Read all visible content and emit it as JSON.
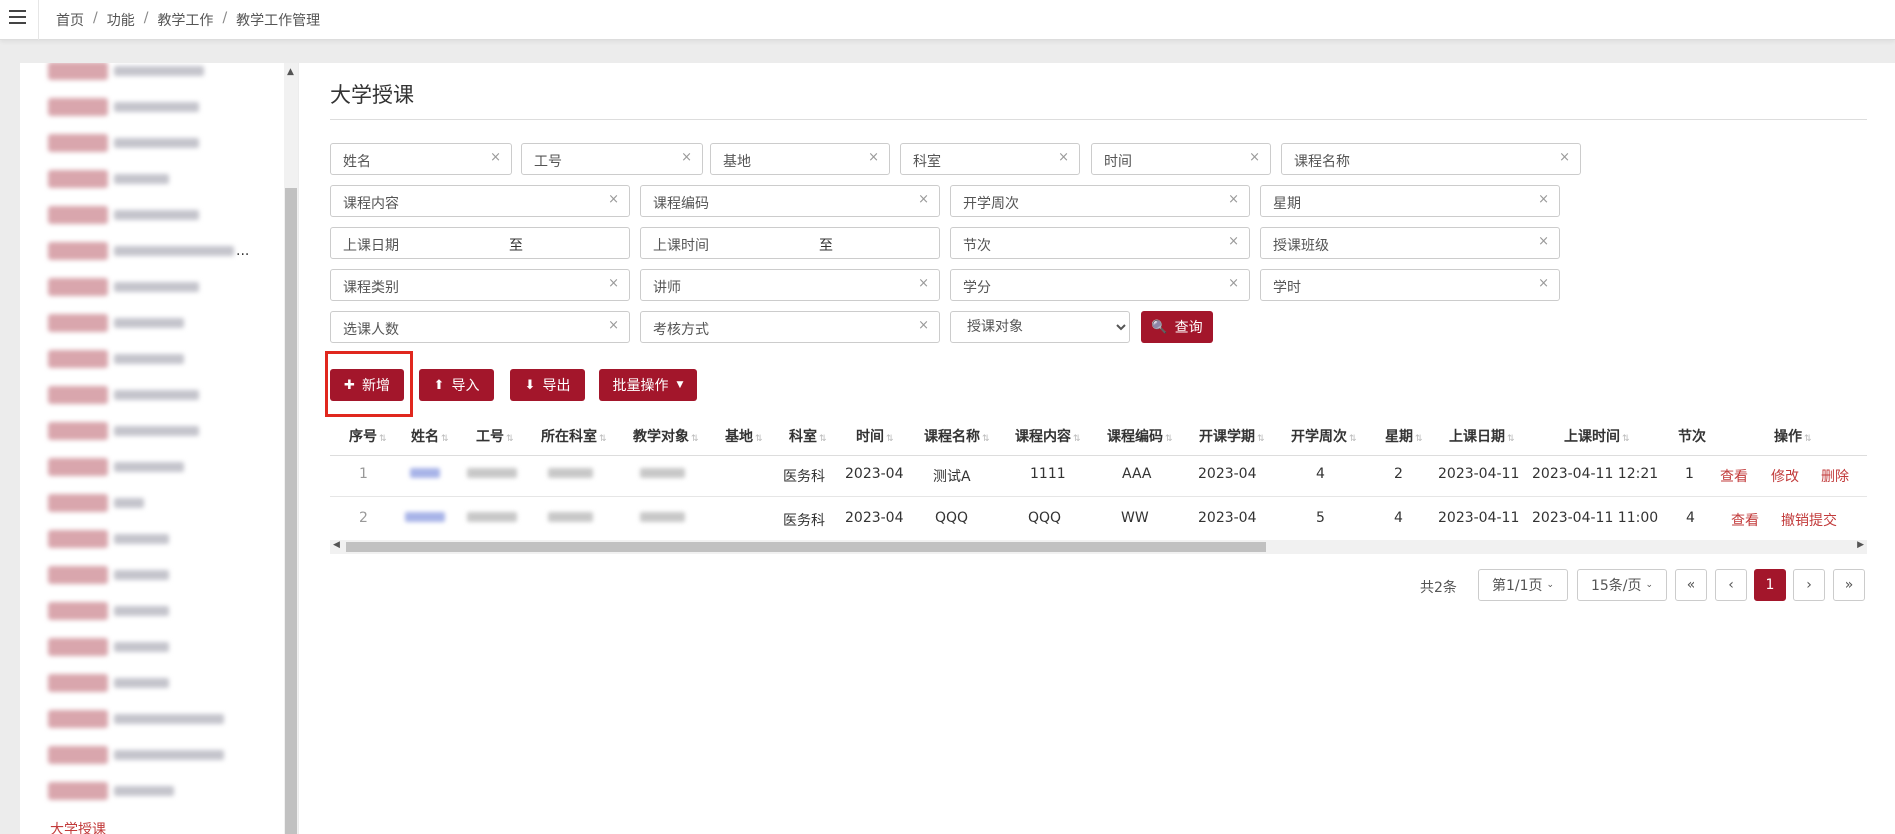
{
  "breadcrumb": [
    "首页",
    "功能",
    "教学工作",
    "教学工作管理"
  ],
  "page_title": "大学授课",
  "sidebar": {
    "active_label": "大学授课",
    "blurred_items": [
      {
        "text_w": 90
      },
      {
        "text_w": 85
      },
      {
        "text_w": 85
      },
      {
        "text_w": 55
      },
      {
        "text_w": 85
      },
      {
        "text_w": 120,
        "ellipsis": "..."
      },
      {
        "text_w": 85
      },
      {
        "text_w": 70
      },
      {
        "text_w": 70
      },
      {
        "text_w": 85
      },
      {
        "text_w": 85
      },
      {
        "text_w": 70
      },
      {
        "text_w": 30
      },
      {
        "text_w": 55
      },
      {
        "text_w": 55
      },
      {
        "text_w": 55
      },
      {
        "text_w": 55
      },
      {
        "text_w": 55
      },
      {
        "text_w": 110
      },
      {
        "text_w": 110
      },
      {
        "text_w": 60
      }
    ]
  },
  "filters": {
    "name": "姓名",
    "job_no": "工号",
    "base": "基地",
    "dept": "科室",
    "time": "时间",
    "course_name": "课程名称",
    "course_content": "课程内容",
    "course_code": "课程编码",
    "start_week": "开学周次",
    "weekday": "星期",
    "class_date": "上课日期",
    "class_time": "上课时间",
    "to": "至",
    "period": "节次",
    "class_group": "授课班级",
    "course_type": "课程类别",
    "lecturer": "讲师",
    "credit": "学分",
    "hours": "学时",
    "enroll_count": "选课人数",
    "exam_method": "考核方式",
    "target_select": "授课对象",
    "clear": "×"
  },
  "buttons": {
    "query": "查询",
    "add": "新增",
    "import": "导入",
    "export": "导出",
    "batch": "批量操作"
  },
  "table": {
    "columns": [
      "序号",
      "姓名",
      "工号",
      "所在科室",
      "教学对象",
      "基地",
      "科室",
      "时间",
      "课程名称",
      "课程内容",
      "课程编码",
      "开课学期",
      "开学周次",
      "星期",
      "上课日期",
      "上课时间",
      "节次",
      "操作"
    ],
    "rows": [
      {
        "seq": "1",
        "dept": "医务科",
        "time": "2023-04",
        "course_name": "测试A",
        "course_content": "1111",
        "course_code": "AAA",
        "term": "2023-04",
        "week": "4",
        "weekday": "2",
        "date": "2023-04-11",
        "datetime": "2023-04-11 12:21",
        "period": "1",
        "actions": [
          "查看",
          "修改",
          "删除"
        ]
      },
      {
        "seq": "2",
        "dept": "医务科",
        "time": "2023-04",
        "course_name": "QQQ",
        "course_content": "QQQ",
        "course_code": "WW",
        "term": "2023-04",
        "week": "5",
        "weekday": "4",
        "date": "2023-04-11",
        "datetime": "2023-04-11 11:00",
        "period": "4",
        "actions": [
          "查看",
          "撤销提交"
        ]
      }
    ]
  },
  "pager": {
    "total": "共2条",
    "page_select": "第1/1页",
    "size_select": "15条/页",
    "first": "«",
    "prev": "‹",
    "current": "1",
    "next": "›",
    "last": "»"
  },
  "colors": {
    "primary": "#a3162b",
    "link": "#c23b3b",
    "highlight": "#e0271e"
  }
}
